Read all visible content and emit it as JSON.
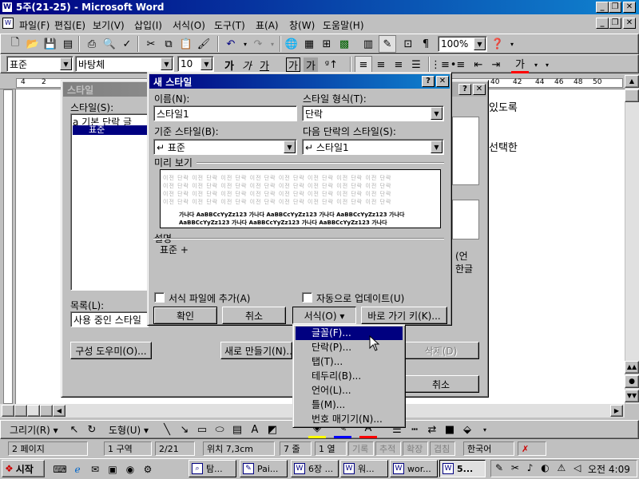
{
  "window": {
    "title": "5주(21-25) - Microsoft Word"
  },
  "menubar": [
    "파일(F)",
    "편집(E)",
    "보기(V)",
    "삽입(I)",
    "서식(O)",
    "도구(T)",
    "표(A)",
    "창(W)",
    "도움말(H)"
  ],
  "toolbar": {
    "zoom": "100%"
  },
  "format_toolbar": {
    "style": "표준",
    "font": "바탕체",
    "size": "10",
    "bold": "가",
    "italic": "가",
    "underline": "가",
    "outline": "가",
    "emboss": "가",
    "bullets": "가",
    "color_a": "가"
  },
  "ruler": {
    "ticks": [
      "4",
      "2",
      "40",
      "42",
      "44",
      "46",
      "48",
      "50"
    ]
  },
  "document": {
    "lines": [
      "있도록",
      "선택한",
      "(언",
      "한글"
    ]
  },
  "style_dialog": {
    "title": "스타일",
    "styles_label": "스타일(S):",
    "styles": [
      "a  기본 단락 글",
      "표준"
    ],
    "list_label": "목록(L):",
    "list_value": "사용 중인 스타일",
    "organizer_button": "구성 도우미(O)...",
    "new_button": "새로 만들기(N)...",
    "delete_button": "삭제(D)",
    "cancel_button": "취소"
  },
  "new_style_dialog": {
    "title": "새 스타일",
    "name_label": "이름(N):",
    "name_value": "스타일1",
    "type_label": "스타일 형식(T):",
    "type_value": "단락",
    "based_on_label": "기준 스타일(B):",
    "based_on_value": "↵ 표준",
    "next_style_label": "다음 단락의 스타일(S):",
    "next_style_value": "↵ 스타일1",
    "preview_label": "미리 보기",
    "preview_sample_gray": "이전 단락 이전 단락 이전 단락 이전 단락 이전 단락 이전 단락 이전 단락 이전 단락",
    "preview_sample_bold": "가나다 AaBBCcYyZz123 가나다 AaBBCcYyZz123 가나다 AaBBCcYyZz123 가나다",
    "preview_sample_bold2": "AaBBCcYyZz123   가나다   AaBBCcYyZz123   가나다   AaBBCcYyZz123   가나다",
    "description_label": "설명",
    "description_value": "표준 +",
    "add_to_template": "서식 파일에 추가(A)",
    "auto_update": "자동으로 업데이트(U)",
    "ok_button": "확인",
    "cancel_button": "취소",
    "format_button": "서식(O) ▾",
    "shortcut_button": "바로 가기 키(K)..."
  },
  "format_menu": [
    "글꼴(F)...",
    "단락(P)...",
    "탭(T)...",
    "테두리(B)...",
    "언어(L)...",
    "틀(M)...",
    "번호 매기기(N)..."
  ],
  "drawing_toolbar": {
    "draw": "그리기(R) ▾",
    "autoshapes": "도형(U) ▾"
  },
  "statusbar": {
    "page": "2 페이지",
    "section": "1 구역",
    "pages": "2/21",
    "position": "위치 7,3cm",
    "line": "7 줄",
    "col": "1 열",
    "rec": "기록",
    "trk": "추적",
    "ext": "확장",
    "ovr": "겹침",
    "lang": "한국어"
  },
  "taskbar": {
    "start": "시작",
    "items": [
      "탐...",
      "Pai...",
      "6장 ...",
      "워...",
      "wor...",
      "5..."
    ],
    "clock": "오전 4:09"
  },
  "colors": {
    "titlebar": "#000080",
    "face": "#c0c0c0",
    "menu_highlight": "#000080"
  }
}
